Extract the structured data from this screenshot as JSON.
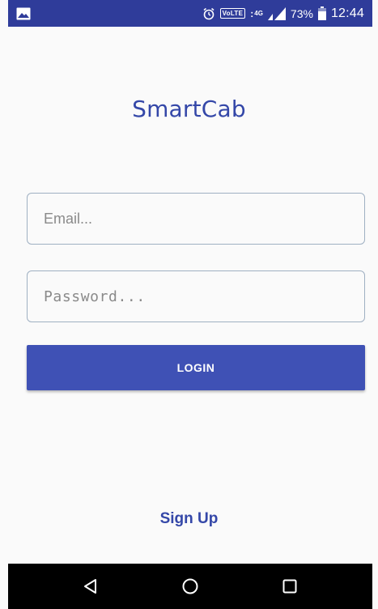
{
  "status_bar": {
    "icons": [
      "gallery-icon",
      "alarm-icon",
      "volte-badge",
      "signal-icon",
      "battery-icon"
    ],
    "volte_label": "VoLTE",
    "network_label": "4G",
    "battery_percent": "73%",
    "time": "12:44",
    "background_color": "#2f3c9a"
  },
  "app": {
    "title": "SmartCab",
    "accent_color": "#3f51b5"
  },
  "login_form": {
    "email_placeholder": "Email...",
    "email_value": "",
    "password_placeholder": "Password...",
    "password_value": "",
    "login_label": "LOGIN",
    "signup_label": "Sign Up"
  },
  "nav_bar": {
    "icons": [
      "back-icon",
      "home-icon",
      "recents-icon"
    ]
  }
}
